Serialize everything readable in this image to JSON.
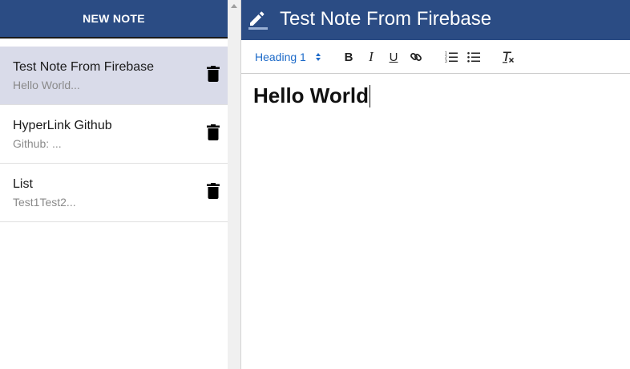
{
  "sidebar": {
    "new_note_label": "NEW NOTE",
    "notes": [
      {
        "title": "Test Note From Firebase",
        "preview": "Hello World..."
      },
      {
        "title": "HyperLink Github",
        "preview": "Github: ..."
      },
      {
        "title": "List",
        "preview": "Test1Test2..."
      }
    ],
    "selected_index": 0
  },
  "editor": {
    "title": "Test Note From Firebase",
    "toolbar": {
      "heading_value": "Heading 1",
      "bold_glyph": "B",
      "italic_glyph": "I",
      "underline_glyph": "U"
    },
    "content_heading": "Hello World"
  },
  "colors": {
    "header_bg": "#2b4c84",
    "selected_row": "#d9dbe9",
    "picker_accent": "#1e6bc9"
  },
  "icons": {
    "edit": "pencil-icon",
    "delete": "trash-icon",
    "link": "link-icon",
    "ordered_list": "ordered-list-icon",
    "bullet_list": "bullet-list-icon",
    "clear_format": "clear-format-icon"
  }
}
